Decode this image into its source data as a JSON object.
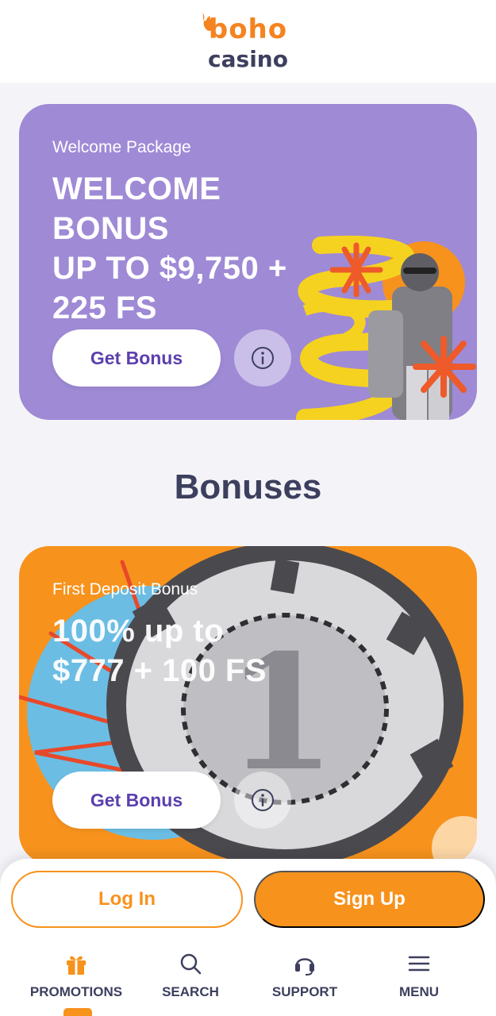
{
  "header": {
    "logo_top": "boho",
    "logo_bottom": "casino"
  },
  "welcome_card": {
    "subtitle": "Welcome Package",
    "title_line1": "WELCOME",
    "title_line2": "BONUS",
    "title_line3": "UP TO $9,750 +",
    "title_line4": "225 FS",
    "button_label": "Get Bonus",
    "info_icon": "info-icon",
    "background_color": "#9f8ad6"
  },
  "section": {
    "title": "Bonuses"
  },
  "first_deposit_card": {
    "subtitle": "First Deposit Bonus",
    "title_line1": "100% up to",
    "title_line2": "$777 + 100 FS",
    "button_label": "Get Bonus",
    "info_icon": "info-icon",
    "background_color": "#f7921d"
  },
  "auth": {
    "login_label": "Log In",
    "signup_label": "Sign Up"
  },
  "nav": {
    "items": [
      {
        "label": "PROMOTIONS",
        "icon": "gift-icon",
        "active": true
      },
      {
        "label": "SEARCH",
        "icon": "search-icon",
        "active": false
      },
      {
        "label": "SUPPORT",
        "icon": "headset-icon",
        "active": false
      },
      {
        "label": "MENU",
        "icon": "hamburger-icon",
        "active": false
      }
    ]
  },
  "colors": {
    "accent": "#f7921d",
    "text_dark": "#3d3f5e",
    "button_text": "#5b3fae"
  }
}
